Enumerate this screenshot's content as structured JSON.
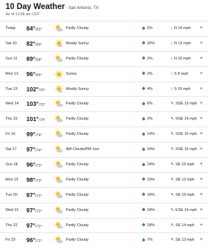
{
  "header": {
    "title": "10 Day Weather",
    "location": " - San Antonio, TX",
    "as_of": "As of 11:08 am CDT"
  },
  "days": [
    {
      "day": "Today",
      "hi": "84°",
      "lo": "/63°",
      "icon": "partly-cloudy",
      "cond": "Partly Cloudy",
      "rain": "5%",
      "wind_arrow": "↓",
      "wind": "N 14 mph"
    },
    {
      "day": "Sat 10",
      "hi": "82°",
      "lo": "/60°",
      "icon": "mostly-sunny",
      "cond": "Mostly Sunny",
      "rain": "20%",
      "wind_arrow": "↓",
      "wind": "N 13 mph"
    },
    {
      "day": "Sun 11",
      "hi": "89°",
      "lo": "/58°",
      "icon": "partly-cloudy",
      "cond": "Partly Cloudy",
      "rain": "2%",
      "wind_arrow": "↓",
      "wind": "N 10 mph"
    },
    {
      "day": "Mon 12",
      "hi": "96°",
      "lo": "/66°",
      "icon": "sunny",
      "cond": "Sunny",
      "rain": "2%",
      "wind_arrow": "↑",
      "wind": "S 8 mph"
    },
    {
      "day": "Tue 13",
      "hi": "102°",
      "lo": "/70°",
      "icon": "mostly-sunny",
      "cond": "Mostly Sunny",
      "rain": "4%",
      "wind_arrow": "↑",
      "wind": "S 15 mph"
    },
    {
      "day": "Wed 14",
      "hi": "103°",
      "lo": "/72°",
      "icon": "partly-cloudy",
      "cond": "Partly Cloudy",
      "rain": "6%",
      "wind_arrow": "↖",
      "wind": "SSE 13 mph"
    },
    {
      "day": "Thu 15",
      "hi": "101°",
      "lo": "/74°",
      "icon": "partly-cloudy",
      "cond": "Partly Cloudy",
      "rain": "2%",
      "wind_arrow": "↖",
      "wind": "SSE 14 mph"
    },
    {
      "day": "Fri 16",
      "hi": "99°",
      "lo": "/74°",
      "icon": "partly-cloudy",
      "cond": "Partly Cloudy",
      "rain": "14%",
      "wind_arrow": "↖",
      "wind": "SSE 15 mph"
    },
    {
      "day": "Sat 17",
      "hi": "97°",
      "lo": "/74°",
      "icon": "partly-cloudy",
      "cond": "AM Clouds/PM Sun",
      "rain": "24%",
      "wind_arrow": "↖",
      "wind": "SSE 15 mph"
    },
    {
      "day": "Sun 18",
      "hi": "96°",
      "lo": "/73°",
      "icon": "partly-cloudy",
      "cond": "Partly Cloudy",
      "rain": "24%",
      "wind_arrow": "↖",
      "wind": "SE 15 mph"
    },
    {
      "day": "Mon 19",
      "hi": "98°",
      "lo": "/73°",
      "icon": "partly-cloudy",
      "cond": "Partly Cloudy",
      "rain": "19%",
      "wind_arrow": "↖",
      "wind": "SE 12 mph"
    },
    {
      "day": "Tue 20",
      "hi": "97°",
      "lo": "/72°",
      "icon": "partly-cloudy",
      "cond": "Partly Cloudy",
      "rain": "18%",
      "wind_arrow": "↖",
      "wind": "SE 10 mph"
    },
    {
      "day": "Wed 21",
      "hi": "97°",
      "lo": "/72°",
      "icon": "partly-cloudy",
      "cond": "Partly Cloudy",
      "rain": "24%",
      "wind_arrow": "↖",
      "wind": "ESE 14 mph"
    },
    {
      "day": "Thu 22",
      "hi": "97°",
      "lo": "/72°",
      "icon": "partly-cloudy",
      "cond": "Partly Cloudy",
      "rain": "18%",
      "wind_arrow": "↖",
      "wind": "SE 14 mph"
    },
    {
      "day": "Fri 23",
      "hi": "96°",
      "lo": "/72°",
      "icon": "partly-cloudy",
      "cond": "Partly Cloudy",
      "rain": "7%",
      "wind_arrow": "↖",
      "wind": "SE 13 mph"
    }
  ],
  "expand_glyph": "+",
  "colors": {
    "sun": "#f4b400",
    "cloud": "#c7ccd1",
    "rain": "#3a7bd5",
    "divider": "#e5e5e5"
  }
}
